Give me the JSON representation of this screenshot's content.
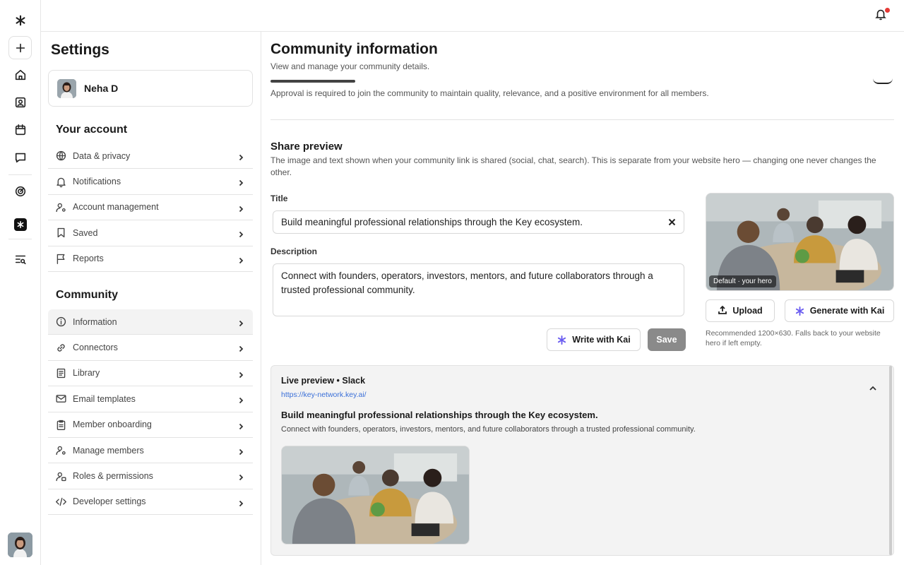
{
  "rail": {
    "items": [
      {
        "name": "logo-icon"
      },
      {
        "name": "plus-icon"
      },
      {
        "name": "home-icon"
      },
      {
        "name": "contacts-icon"
      },
      {
        "name": "calendar-icon"
      },
      {
        "name": "chat-icon"
      },
      {
        "name": "analytics-icon"
      },
      {
        "name": "app-icon"
      },
      {
        "name": "search-list-icon"
      }
    ]
  },
  "topbar": {
    "notification_icon": "bell-icon"
  },
  "settings": {
    "title": "Settings",
    "user_name": "Neha D",
    "account_heading": "Your account",
    "account_items": [
      {
        "label": "Data & privacy",
        "icon": "globe-icon"
      },
      {
        "label": "Notifications",
        "icon": "bell-icon"
      },
      {
        "label": "Account management",
        "icon": "user-gear-icon"
      },
      {
        "label": "Saved",
        "icon": "bookmark-icon"
      },
      {
        "label": "Reports",
        "icon": "flag-icon"
      }
    ],
    "community_heading": "Community",
    "community_items": [
      {
        "label": "Information",
        "icon": "info-icon"
      },
      {
        "label": "Connectors",
        "icon": "link-icon"
      },
      {
        "label": "Library",
        "icon": "book-icon"
      },
      {
        "label": "Email templates",
        "icon": "mail-icon"
      },
      {
        "label": "Member onboarding",
        "icon": "clipboard-icon"
      },
      {
        "label": "Manage members",
        "icon": "user-gear-icon"
      },
      {
        "label": "Roles & permissions",
        "icon": "user-key-icon"
      },
      {
        "label": "Developer settings",
        "icon": "code-icon"
      }
    ]
  },
  "main": {
    "title": "Community information",
    "subtitle": "View and manage your community details.",
    "approval_text": "Approval is required to join the community to maintain quality, relevance, and a positive environment for all members.",
    "share": {
      "heading": "Share preview",
      "description": "The image and text shown when your community link is shared (social, chat, search). This is separate from your website hero — changing one never changes the other.",
      "title_label": "Title",
      "title_value": "Build meaningful professional relationships through the Key ecosystem.",
      "description_label": "Description",
      "description_value": "Connect with founders, operators, investors, mentors, and future collaborators through a trusted professional community.",
      "write_with_kai": "Write with Kai",
      "save": "Save",
      "hero_tag": "Default · your hero",
      "upload": "Upload",
      "generate_with_kai": "Generate with Kai",
      "recommendation": "Recommended 1200×630. Falls back to your website hero if left empty."
    },
    "live_preview": {
      "heading": "Live preview • Slack",
      "url": "https://key-network.key.ai/",
      "title": "Build meaningful professional relationships through the Key ecosystem.",
      "description": "Connect with founders, operators, investors, mentors, and future collaborators through a trusted professional community."
    }
  }
}
